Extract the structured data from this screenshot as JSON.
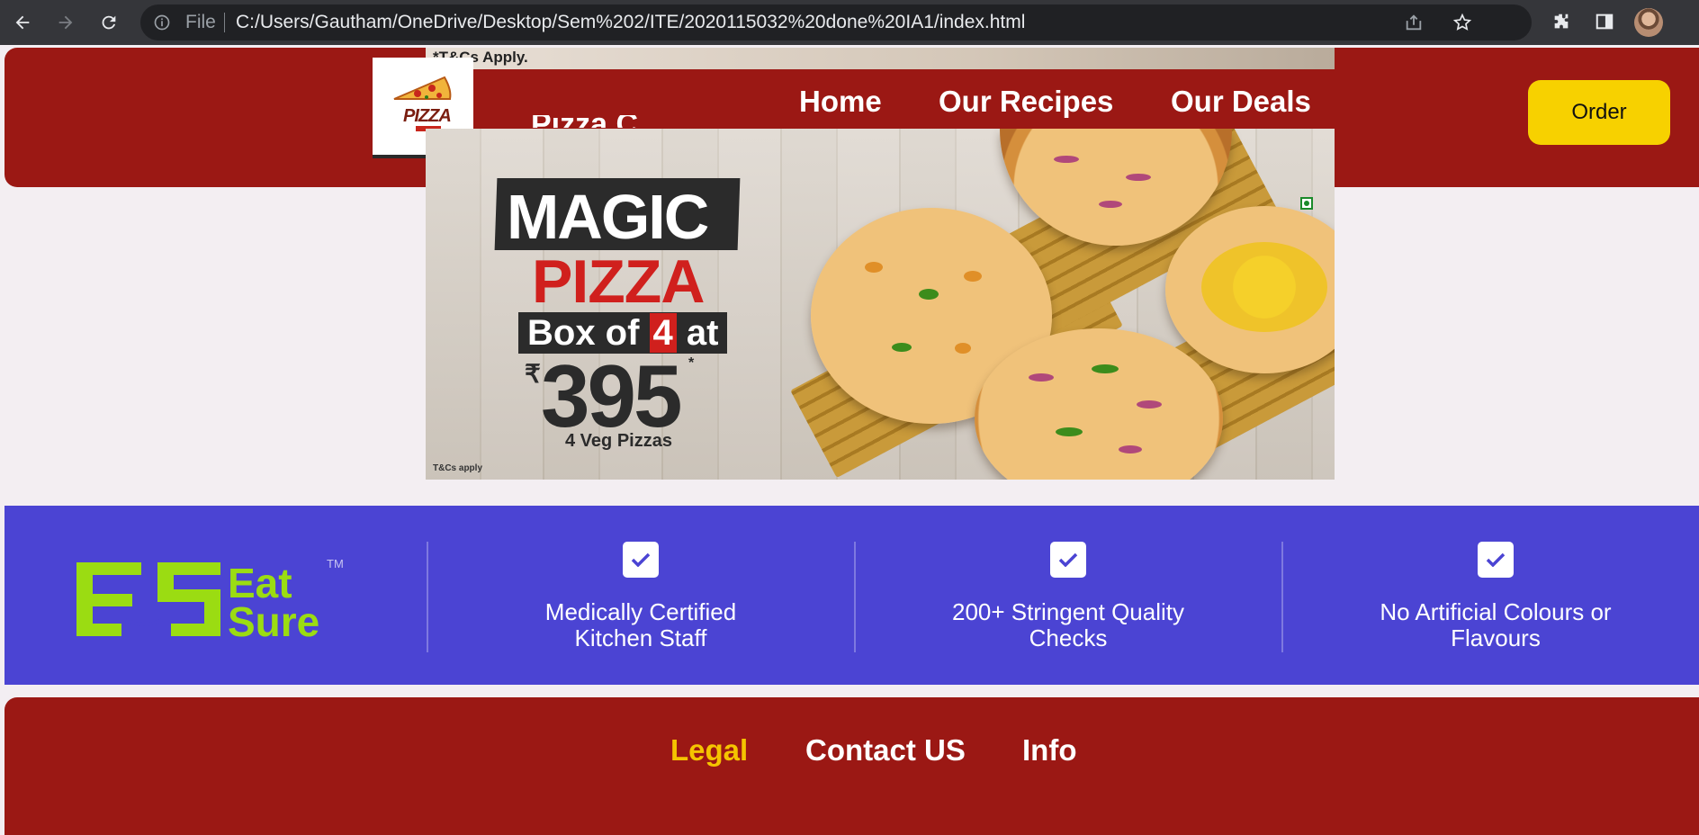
{
  "browser": {
    "file_label": "File",
    "url": "C:/Users/Gautham/OneDrive/Desktop/Sem%202/ITE/2020115032%20done%20IA1/index.html"
  },
  "header": {
    "promo_note": "*T&Cs Apply.",
    "logo_text": "PIZZA",
    "brand_peek": "Pizza C",
    "nav": [
      {
        "label": "Home"
      },
      {
        "label": "Our Recipes"
      },
      {
        "label": "Our Deals"
      }
    ],
    "order_label": "Order"
  },
  "hero": {
    "headline": "MAGIC",
    "subhead": "PIZZA",
    "box_prefix": "Box of ",
    "box_count": "4",
    "box_suffix": " at",
    "currency": "₹",
    "price": "395",
    "price_mark": "*",
    "veg_note": "4 Veg Pizzas",
    "tnc": "T&Cs apply"
  },
  "features": {
    "brand_line1": "Eat",
    "brand_line2": "Sure",
    "brand_tm": "TM",
    "items": [
      {
        "line1": "Medically Certified",
        "line2": "Kitchen Staff"
      },
      {
        "line1": "200+ Stringent Quality",
        "line2": "Checks"
      },
      {
        "line1": "No Artificial Colours or",
        "line2": "Flavours"
      }
    ]
  },
  "footer": {
    "links": [
      {
        "label": "Legal",
        "color": "#f5c400"
      },
      {
        "label": "Contact US",
        "color": "#ffffff"
      },
      {
        "label": "Info",
        "color": "#ffffff"
      }
    ]
  },
  "colors": {
    "header_red": "#9b1814",
    "order_yellow": "#f7d100",
    "feature_blue": "#4b44d3",
    "eatsure_green": "#9bdc12"
  }
}
